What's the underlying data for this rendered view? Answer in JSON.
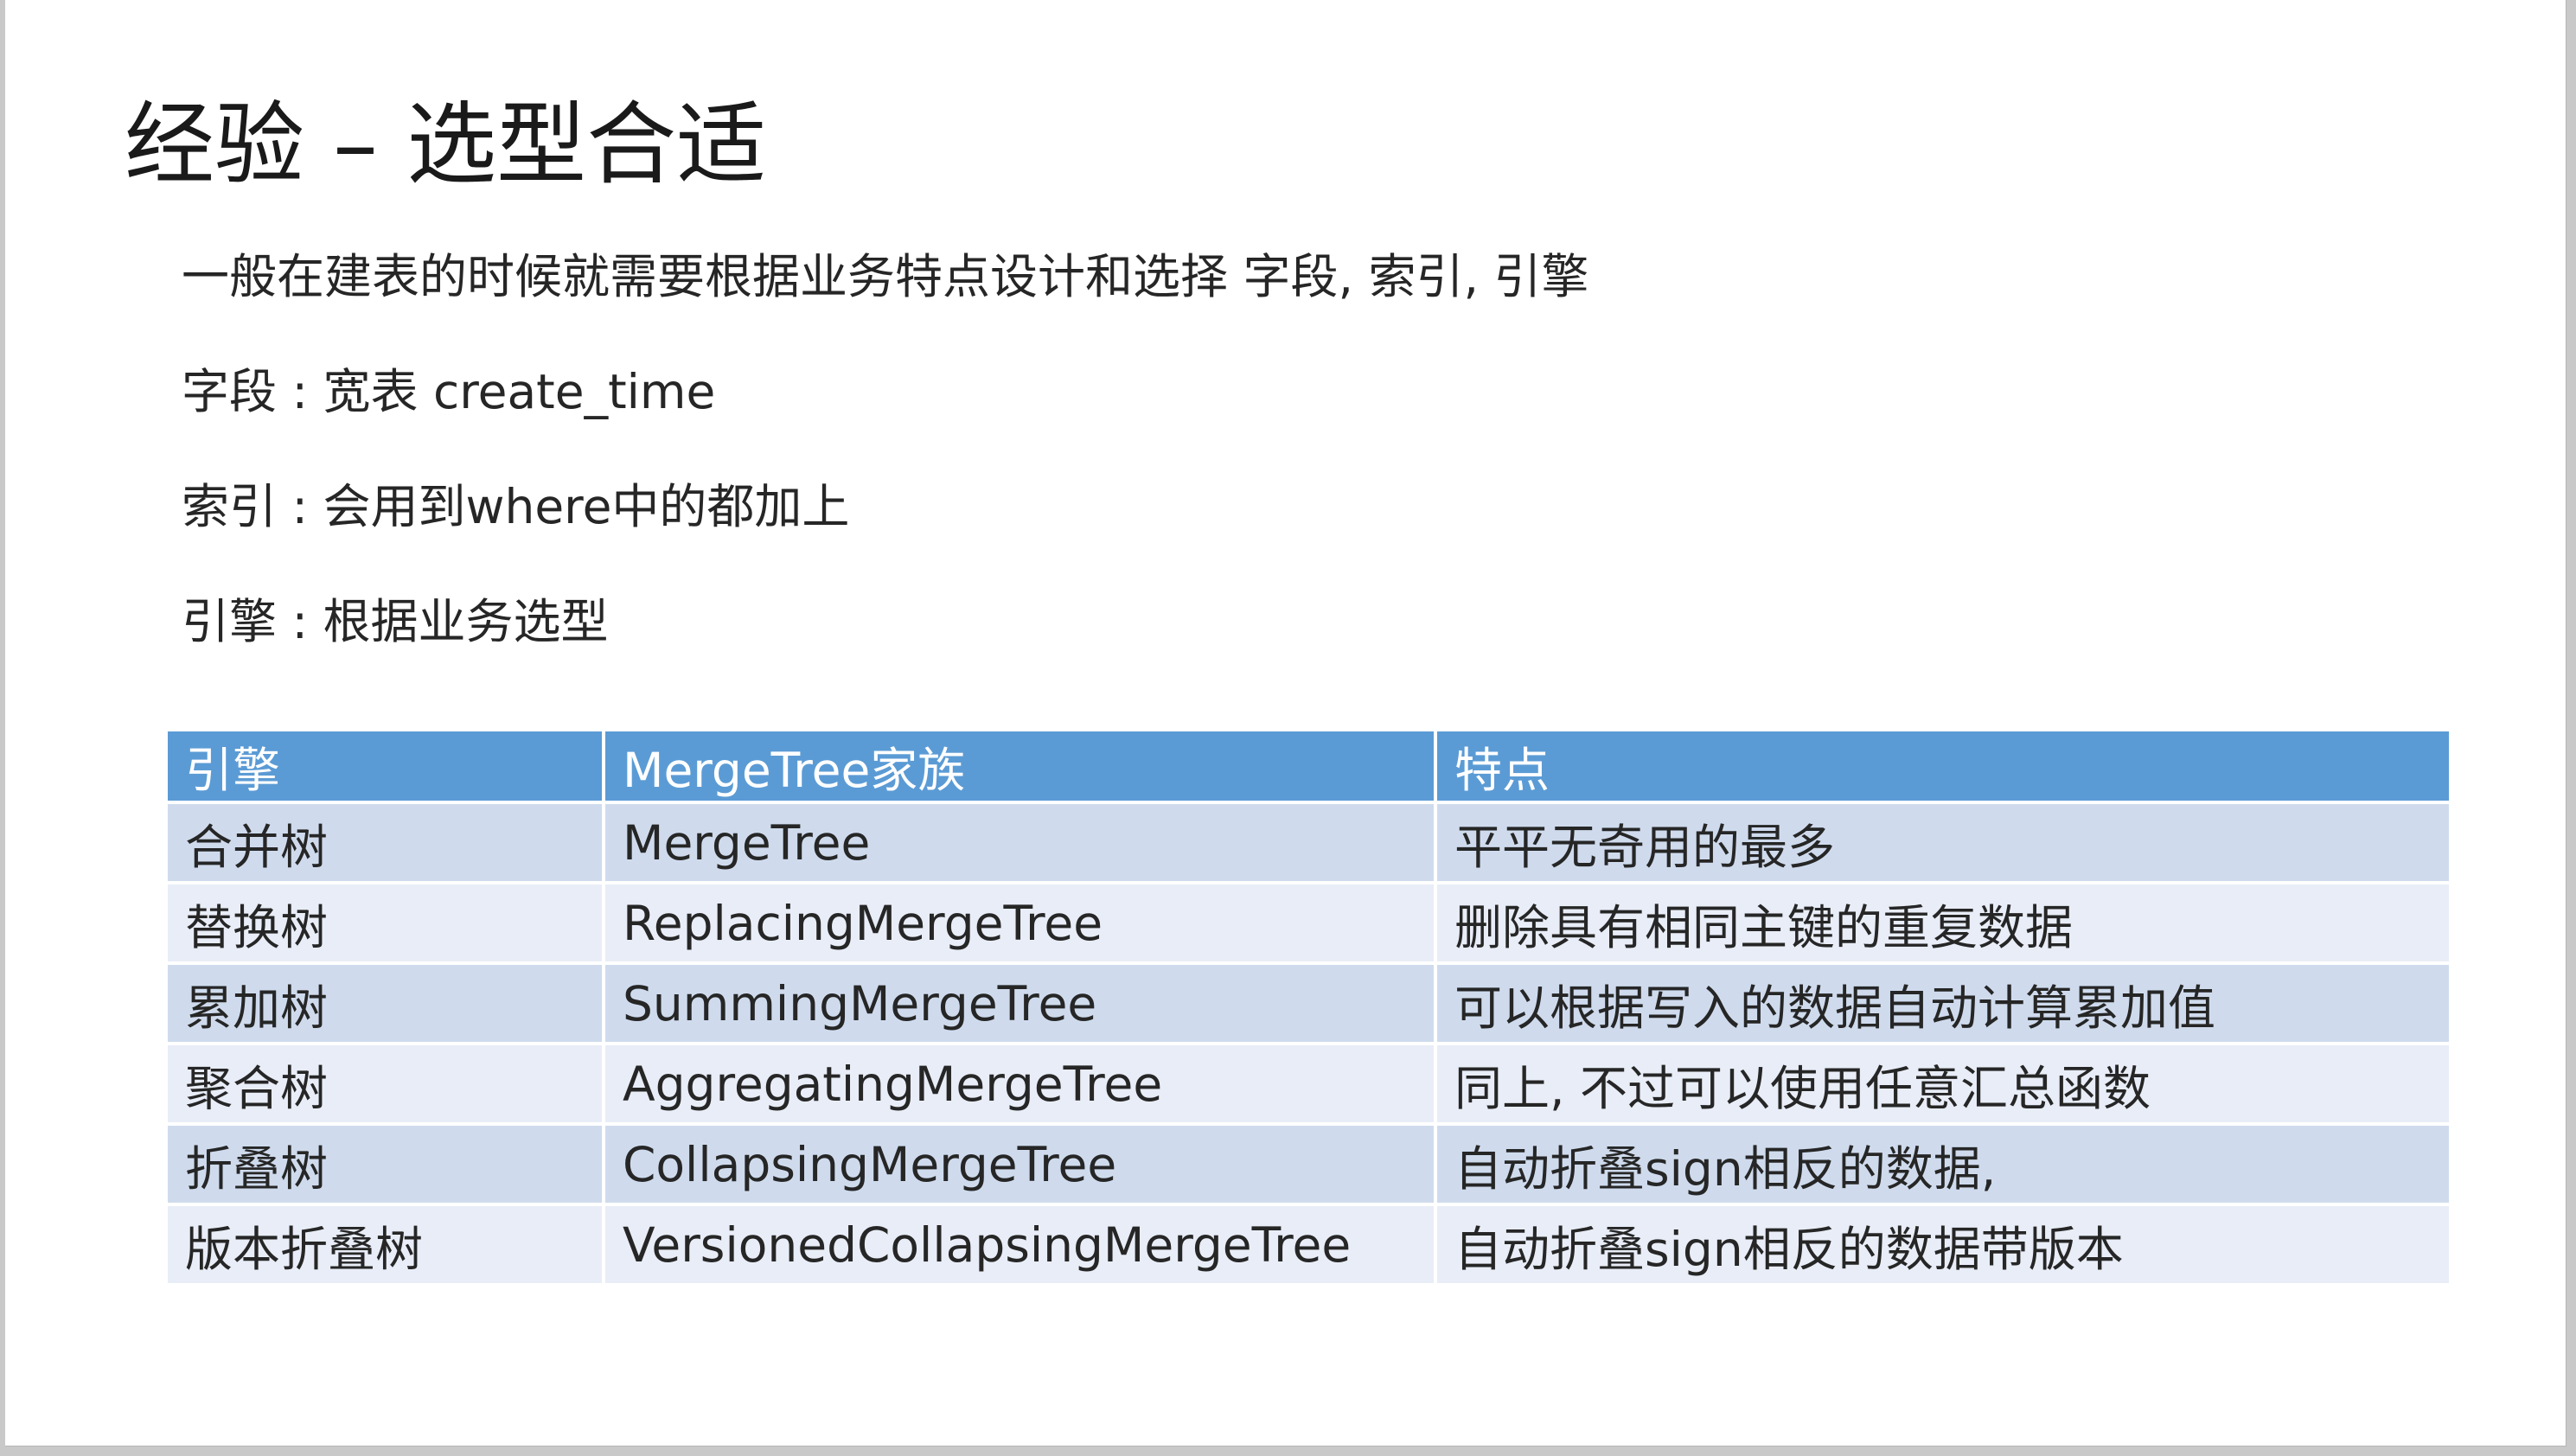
{
  "slide": {
    "title": "经验 – 选型合适",
    "bullets": [
      "一般在建表的时候就需要根据业务特点设计和选择 字段, 索引, 引擎",
      "字段 : 宽表 create_time",
      "索引 : 会用到where中的都加上",
      "引擎 : 根据业务选型"
    ]
  },
  "table": {
    "headers": [
      "引擎",
      "MergeTree家族",
      "特点"
    ],
    "rows": [
      [
        "合并树",
        "MergeTree",
        "平平无奇用的最多"
      ],
      [
        "替换树",
        "ReplacingMergeTree",
        "删除具有相同主键的重复数据"
      ],
      [
        "累加树",
        "SummingMergeTree",
        "可以根据写入的数据自动计算累加值"
      ],
      [
        "聚合树",
        "AggregatingMergeTree",
        "同上, 不过可以使用任意汇总函数"
      ],
      [
        "折叠树",
        "CollapsingMergeTree",
        "自动折叠sign相反的数据,"
      ],
      [
        "版本折叠树",
        "VersionedCollapsingMergeTree",
        "自动折叠sign相反的数据带版本"
      ]
    ]
  },
  "colors": {
    "header_bg": "#5b9bd5",
    "row_odd_bg": "#cfdbed",
    "row_even_bg": "#e8edf7"
  }
}
